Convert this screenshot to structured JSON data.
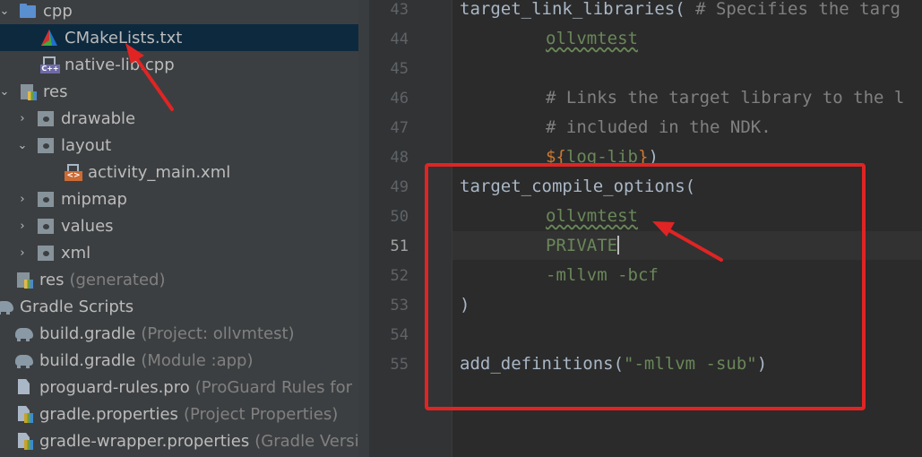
{
  "tree": {
    "items": [
      {
        "label": "cpp",
        "hint": ""
      },
      {
        "label": "CMakeLists.txt",
        "hint": ""
      },
      {
        "label": "native-lib.cpp",
        "hint": ""
      },
      {
        "label": "res",
        "hint": ""
      },
      {
        "label": "drawable",
        "hint": ""
      },
      {
        "label": "layout",
        "hint": ""
      },
      {
        "label": "activity_main.xml",
        "hint": ""
      },
      {
        "label": "mipmap",
        "hint": ""
      },
      {
        "label": "values",
        "hint": ""
      },
      {
        "label": "xml",
        "hint": ""
      },
      {
        "label": "res",
        "hint": "(generated)"
      },
      {
        "label": "Gradle Scripts",
        "hint": ""
      },
      {
        "label": "build.gradle",
        "hint": "(Project: ollvmtest)"
      },
      {
        "label": "build.gradle",
        "hint": "(Module :app)"
      },
      {
        "label": "proguard-rules.pro",
        "hint": "(ProGuard Rules for \":ap"
      },
      {
        "label": "gradle.properties",
        "hint": "(Project Properties)"
      },
      {
        "label": "gradle-wrapper.properties",
        "hint": "(Gradle Version)"
      }
    ]
  },
  "editor": {
    "line_numbers": [
      "43",
      "44",
      "45",
      "46",
      "47",
      "48",
      "49",
      "50",
      "51",
      "52",
      "53",
      "54",
      "55"
    ],
    "current_line": "51",
    "code": {
      "l43_fn": "target_link_libraries(",
      "l43_comment": " # Specifies the targ",
      "l44_arg": "ollvmtest",
      "l46_comment": "# Links the target library to the l",
      "l47_comment": "# included in the NDK.",
      "l48_dollar": "$",
      "l48_open": "{",
      "l48_var": "log-lib",
      "l48_close": "}",
      "l48_paren": ")",
      "l49_fn": "target_compile_options(",
      "l50_arg": "ollvmtest",
      "l51_arg": "PRIVATE",
      "l52_arg": "-mllvm -bcf",
      "l53_paren": ")",
      "l55_fn": "add_definitions(",
      "l55_str": "\"-mllvm -sub\"",
      "l55_paren": ")"
    }
  },
  "colors": {
    "annotation": "#e02424",
    "selection": "#0d293e"
  }
}
